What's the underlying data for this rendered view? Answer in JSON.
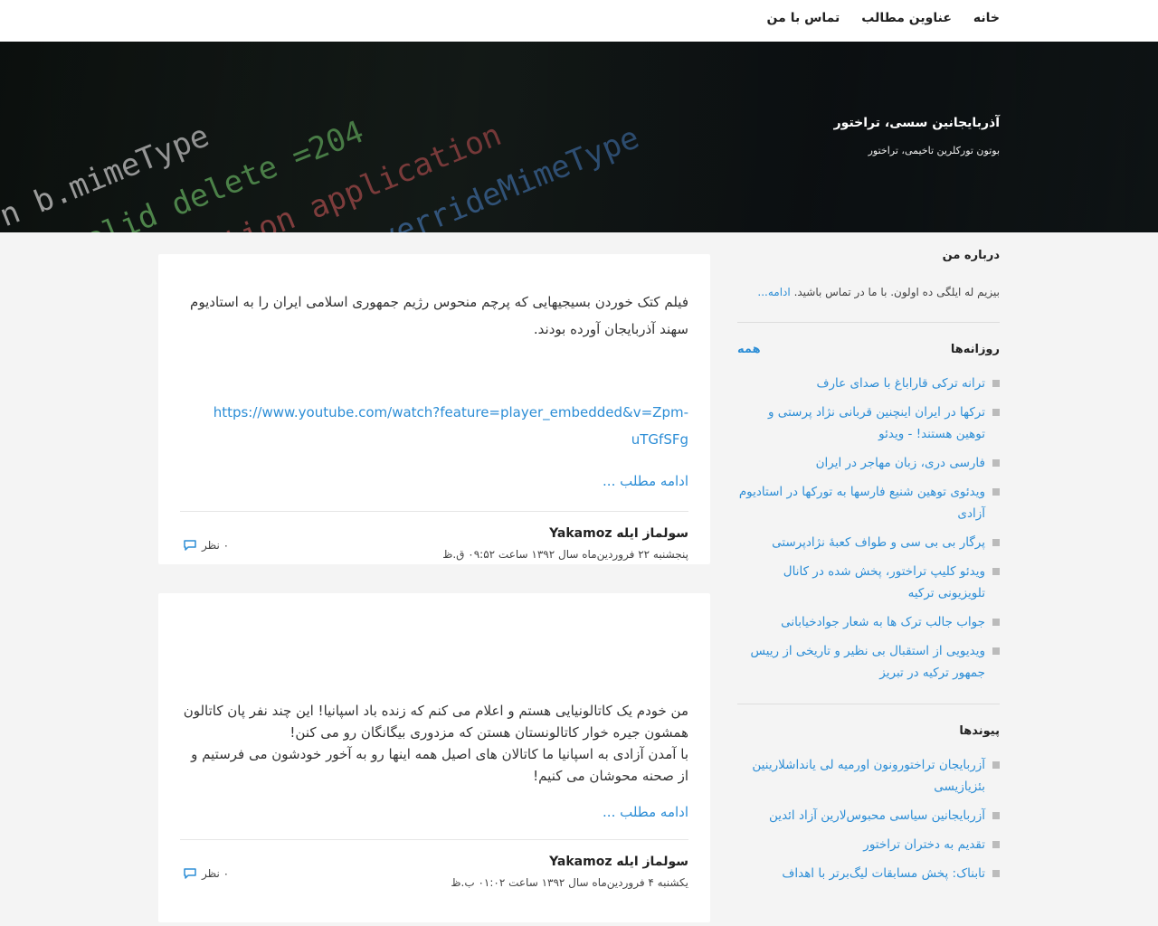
{
  "nav": {
    "items": [
      "خانه",
      "عناوین مطالب",
      "تماس با من"
    ]
  },
  "header": {
    "title": "آذربایجانین سسی، تراختور",
    "description": "بوتون تورکلرین تاخیمی، تراختور"
  },
  "sidebar": {
    "about": {
      "title": "درباره من",
      "text": "بیزیم له ایلگی ده اولون. با ما در تماس باشید.",
      "more": "ادامه..."
    },
    "posts": {
      "title": "روزانه‌ها",
      "all_label": "همه",
      "items": [
        "ترانه ترکی قاراباغ با صدای عارف",
        "ترکها در ایران اینچنین قربانی نژاد پرستی و توهین هستند! - ویدئو",
        "فارسی دری، زبان مهاجر در ایران",
        "ویدئوی توهین شنیع فارسها به تورکها در استادیوم آزادی",
        "پرگار بی بی سی و طواف کعبهٔ نژادپرستی",
        "ویدئو کلیپ تراختور، پخش شده در کانال تلویزیونی ترکیه",
        "جواب جالب ترک ها به شعار جوادخیابانی",
        "ویدیویی از استقبال بی نظیر و تاریخی از رییس جمهور ترکیه در تبریز"
      ]
    },
    "links": {
      "title": "پیوندها",
      "items": [
        "آزربایجان تراختورونون اورمیه لی یانداشلارینین بئزیازیسی",
        "آزربایجانین سیاسی محبوس‌لارین آزاد ائدین",
        "تقدیم به دختران تراختور",
        "تابناک: پخش مسابقات لیگ‌برتر با اهداف"
      ]
    }
  },
  "posts": [
    {
      "text": "فیلم کتک خوردن بسیجیهایی که پرچم منحوس رژیم جمهوری اسلامی ایران را به استادیوم سهند آذربایجان آورده بودند.",
      "link": "https://www.youtube.com/watch?feature=player_embedded&v=Zpm-uTGfSFg",
      "read_more": "ادامه مطلب ...",
      "author": "سولماز ایله Yakamoz",
      "date": "پنجشنبه ۲۲ فروردین‌ماه سال ۱۳۹۲ ساعت ۰۹:۵۲ ق.ظ",
      "comments": "۰ نظر"
    },
    {
      "text_lines": [
        "من خودم یک کاتالونیایی هستم و اعلام می کنم که زنده باد اسپانیا! این چند نفر پان کاتالون همشون جیره خوار کاتالونستان هستن که مزدوری بیگانگان رو می کنن!",
        "با آمدن آزادی به اسپانیا ما کاتالان های اصیل همه اینها رو به آخور خودشون می فرستیم و از صحنه محوشان می کنیم!"
      ],
      "read_more": "ادامه مطلب ...",
      "author": "سولماز ایله Yakamoz",
      "date": "یکشنبه ۴ فروردین‌ماه سال ۱۳۹۲ ساعت ۰۱:۰۲ ب.ظ",
      "comments": "۰ نظر"
    }
  ],
  "colors": {
    "link": "#2d8ed6",
    "background": "#f4f4f4",
    "card": "#ffffff"
  }
}
